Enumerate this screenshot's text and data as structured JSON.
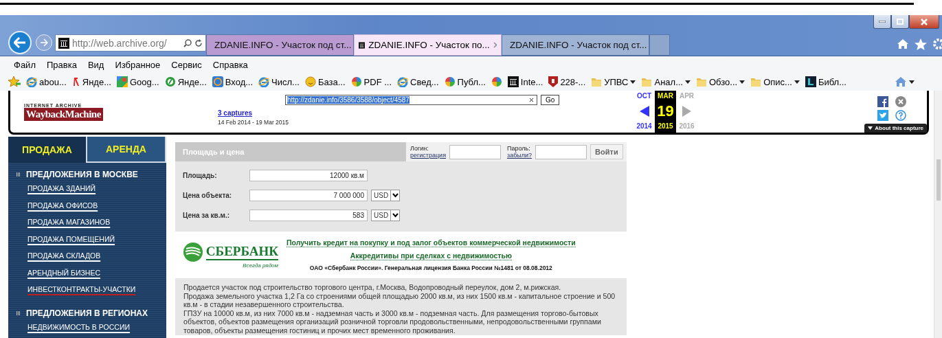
{
  "browser": {
    "address": "http://web.archive.org/"
  },
  "tabs": [
    {
      "title": "ZDANIE.INFO - Участок под ст...",
      "selected": false,
      "kind": "archive",
      "color": "#b99bd2"
    },
    {
      "title": "ZDANIE.INFO - Участок по...",
      "selected": true,
      "kind": "archive",
      "color": "#f7e6f7"
    },
    {
      "title": "ZDANIE.INFO - Участок под ст...",
      "selected": false,
      "kind": "ie",
      "color": "#9fb3d5"
    }
  ],
  "menu": [
    "Файл",
    "Правка",
    "Вид",
    "Избранное",
    "Сервис",
    "Справка"
  ],
  "favorites": [
    {
      "kind": "ie",
      "label": "abou..."
    },
    {
      "kind": "yandex",
      "label": "Янде..."
    },
    {
      "kind": "maps",
      "label": "Goog..."
    },
    {
      "kind": "green",
      "label": "Янде..."
    },
    {
      "kind": "mail",
      "label": "Вход..."
    },
    {
      "kind": "ie",
      "label": "Числ..."
    },
    {
      "kind": "smile",
      "label": "База..."
    },
    {
      "kind": "pinwheel",
      "label": "PDF ..."
    },
    {
      "kind": "ie",
      "label": "Свед..."
    },
    {
      "kind": "pinwheel",
      "label": "Публ..."
    },
    {
      "kind": "pinwheel"
    },
    {
      "kind": "archive",
      "label": "Inte..."
    },
    {
      "kind": "shield",
      "label": "228-..."
    },
    {
      "kind": "folder",
      "label": "УПВС"
    },
    {
      "kind": "folder",
      "label": "Анал..."
    },
    {
      "kind": "folder",
      "label": "Обзо..."
    },
    {
      "kind": "folder",
      "label": "Опис..."
    },
    {
      "kind": "square",
      "label": "Библ..."
    }
  ],
  "wayback": {
    "logo_top": "INTERNET ARCHIVE",
    "logo": "WaybackMachine",
    "url": "http://zdanie.info/3586/3588/object/4587",
    "go": "Go",
    "captures": "3 captures",
    "range": "14 Feb 2014 - 19 Mar 2015",
    "months": [
      {
        "month": "OCT",
        "year": "2014",
        "selected": false,
        "kind": "prev"
      },
      {
        "month": "MAR",
        "day": "19",
        "year": "2015",
        "selected": true,
        "kind": "current"
      },
      {
        "month": "APR",
        "year": "2016",
        "selected": false,
        "kind": "next"
      }
    ],
    "about": "About this capture"
  },
  "sidebar": {
    "tabs": [
      {
        "label": "ПРОДАЖА",
        "selected": true
      },
      {
        "label": "АРЕНДА",
        "selected": false
      }
    ],
    "sections": [
      {
        "title": "ПРЕДЛОЖЕНИЯ В МОСКВЕ",
        "links": [
          {
            "label": "ПРОДАЖА ЗДАНИЙ",
            "selected": false
          },
          {
            "label": "ПРОДАЖА ОФИСОВ",
            "selected": false
          },
          {
            "label": "ПРОДАЖА МАГАЗИНОВ",
            "selected": false
          },
          {
            "label": "ПРОДАЖА ПОМЕЩЕНИЙ",
            "selected": false
          },
          {
            "label": "ПРОДАЖА СКЛАДОВ",
            "selected": false
          },
          {
            "label": "АРЕНДНЫЙ БИЗНЕС",
            "selected": false
          },
          {
            "label": "ИНВЕСТКОНТРАКТЫ-УЧАСТКИ",
            "selected": true
          }
        ]
      },
      {
        "title": "ПРЕДЛОЖЕНИЯ В РЕГИОНАХ",
        "links": [
          {
            "label": "НЕДВИЖИМОСТЬ В РОССИИ",
            "selected": false
          }
        ]
      }
    ]
  },
  "price_panel": {
    "title": "Площадь и цена",
    "login_label": "Логин:",
    "login_link": "регистрация",
    "password_label": "Пароль:",
    "password_link": "забыли?",
    "submit": "Войти",
    "fields": [
      {
        "label": "Площадь:",
        "value": "12000 кв.м"
      },
      {
        "label": "Цена объекта:",
        "value": "7 000 000",
        "currency": "USD"
      },
      {
        "label": "Цена за кв.м.:",
        "value": "583",
        "currency": "USD"
      }
    ]
  },
  "ad": {
    "brand": "СБЕРБАНК",
    "slogan": "Всегда рядом",
    "links": [
      "Получить кредит на покупку и под залог объектов коммерческой недвижимости",
      "Аккредитивы при сделках с недвижимостью"
    ],
    "license": "ОАО «Сбербанк России». Генеральная лицензия Банка России №1481 от 08.08.2012"
  },
  "description": [
    "Продается участок под строительство торгового центра, г.Москва, Водопроводный переулок, дом 2, м.рижская.",
    "Продажа земельного участка 1,2 Га со строениями общей площадью 2000 кв.м, из них 1500 кв.м - капитальное строение и 500 кв.м - в стадии незавершенного строительства.",
    "ГПЗУ на 10000 кв.м, из них 7000 кв.м - надземная часть и 3000 кв.м - подземная часть. Для размещения торгово-бытовых объектов, объектов размещения организаций розничной торговли продовольственными, непродовольственными группами товаров, объекты размещения гостиниц и прочих мест временного проживания."
  ]
}
